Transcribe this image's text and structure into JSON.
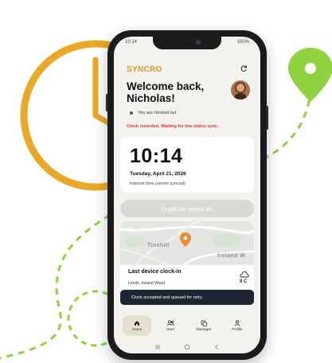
{
  "statusbar": {
    "time": "10:14",
    "battery": "100%"
  },
  "app": {
    "brand": "SYNCRO",
    "accent": "#d99a22"
  },
  "header": {
    "welcome": "Welcome back, Nicholas!"
  },
  "status": {
    "clocked_state": "You are clocked out",
    "alert": "Clock recorded. Waiting for live status sync.",
    "alert_color": "#cf3a3a"
  },
  "clock": {
    "time": "10:14",
    "date": "Tuesday, April 21, 2026",
    "source": "Internet time (server synced)"
  },
  "duplicate_button": {
    "label": "Duplicate period 42"
  },
  "map": {
    "label_left": "Tinshill",
    "label_right": "Ireland W"
  },
  "last_clock": {
    "title": "Last device clock-in",
    "location": "Leeds, Ireland Wood",
    "temperature": "9 C",
    "weather_icon": "cloud-icon"
  },
  "toast": {
    "message": "Clock accepted and queued for retry."
  },
  "nav": {
    "items": [
      {
        "label": "Home",
        "icon": "home-icon"
      },
      {
        "label": "User",
        "icon": "users-icon"
      },
      {
        "label": "Manager",
        "icon": "manager-icon"
      },
      {
        "label": "Profile",
        "icon": "profile-icon"
      }
    ]
  },
  "colors": {
    "decor_yellow": "#e9a825",
    "decor_green": "#8fd23f",
    "toast_bg": "#1f2535"
  }
}
